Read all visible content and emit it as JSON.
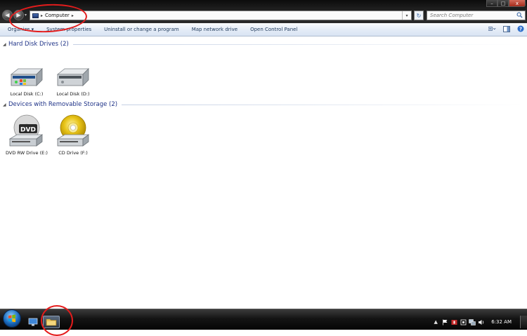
{
  "window": {
    "controls": {
      "minimize": "–",
      "maximize": "□",
      "close": "x"
    }
  },
  "navigation": {
    "back_icon": "back-arrow-icon",
    "forward_icon": "forward-arrow-icon",
    "address": {
      "breadcrumb": "Computer",
      "separator": "▸"
    },
    "search": {
      "placeholder": "Search Computer"
    }
  },
  "toolbar": {
    "organize": "Organize ▾",
    "system_properties": "System properties",
    "uninstall": "Uninstall or change a program",
    "map_drive": "Map network drive",
    "control_panel": "Open Control Panel"
  },
  "groups": [
    {
      "title": "Hard Disk Drives (2)",
      "items": [
        {
          "label": "Local Disk (C:)",
          "icon": "hard-disk-windows-icon"
        },
        {
          "label": "Local Disk (D:)",
          "icon": "hard-disk-icon"
        }
      ]
    },
    {
      "title": "Devices with Removable Storage (2)",
      "items": [
        {
          "label": "DVD RW Drive (E:)",
          "icon": "dvd-drive-icon",
          "icon_text": "DVD"
        },
        {
          "label": "CD Drive (F:)",
          "icon": "cd-drive-icon"
        }
      ]
    }
  ],
  "taskbar": {
    "clock": "6:32 AM"
  },
  "colors": {
    "annotation": "#e41c1c",
    "group_title": "#1e3287",
    "toolbar_text": "#1e395b"
  }
}
